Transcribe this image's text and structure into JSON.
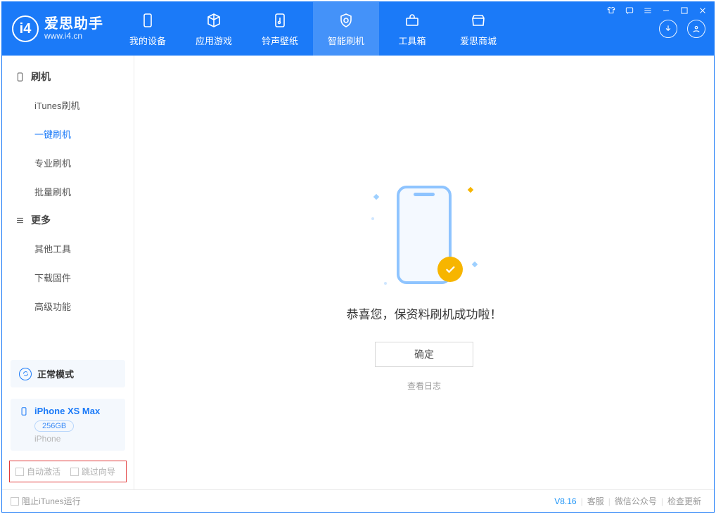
{
  "brand": {
    "name": "爱思助手",
    "url": "www.i4.cn"
  },
  "tabs": {
    "device": "我的设备",
    "apps": "应用游戏",
    "ring": "铃声壁纸",
    "flash": "智能刷机",
    "toolbox": "工具箱",
    "store": "爱思商城"
  },
  "sidebar": {
    "sec_flash": "刷机",
    "items_flash": {
      "itunes": "iTunes刷机",
      "oneclick": "一键刷机",
      "pro": "专业刷机",
      "batch": "批量刷机"
    },
    "sec_more": "更多",
    "items_more": {
      "other": "其他工具",
      "firmware": "下载固件",
      "adv": "高级功能"
    }
  },
  "mode": {
    "label": "正常模式"
  },
  "device": {
    "name": "iPhone XS Max",
    "capacity": "256GB",
    "type": "iPhone"
  },
  "options": {
    "auto_activate": "自动激活",
    "skip_guide": "跳过向导"
  },
  "main": {
    "message": "恭喜您，保资料刷机成功啦！",
    "ok": "确定",
    "view_log": "查看日志"
  },
  "footer": {
    "block_itunes": "阻止iTunes运行",
    "version": "V8.16",
    "support": "客服",
    "wechat": "微信公众号",
    "update": "检查更新"
  }
}
